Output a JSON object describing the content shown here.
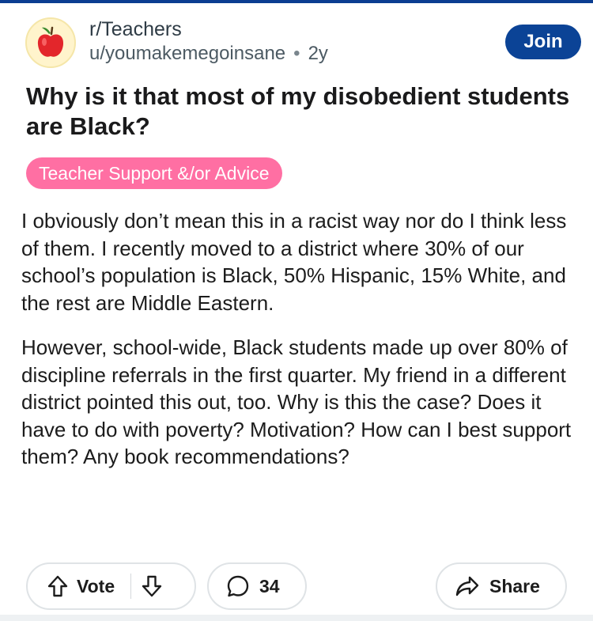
{
  "post": {
    "community": "r/Teachers",
    "author": "u/youmakemegoinsane",
    "separator": "•",
    "age": "2y",
    "join_label": "Join",
    "title": "Why is it that most of my disobedient students are Black?",
    "flair": "Teacher Support &/or Advice",
    "paragraphs": [
      "I obviously don’t mean this in a racist way nor do I think less of them. I recently moved to a district where 30% of our school’s population is Black, 50% Hispanic, 15% White, and the rest are Middle Eastern.",
      "However, school-wide, Black students made up over 80% of discipline referrals in the first quarter. My friend in a different district pointed this out, too. Why is this the case? Does it have to do with poverty? Motivation? How can I best support them? Any book recommendations?"
    ]
  },
  "actions": {
    "vote_label": "Vote",
    "comment_count": "34",
    "share_label": "Share"
  },
  "icons": {
    "avatar": "apple-icon",
    "upvote": "arrow-up-icon",
    "downvote": "arrow-down-icon",
    "comment": "comment-bubble-icon",
    "share": "share-arrow-icon"
  },
  "colors": {
    "join_button": "#0b4396",
    "flair_background": "#ff6fa3",
    "top_strip": "#0b3d91"
  }
}
